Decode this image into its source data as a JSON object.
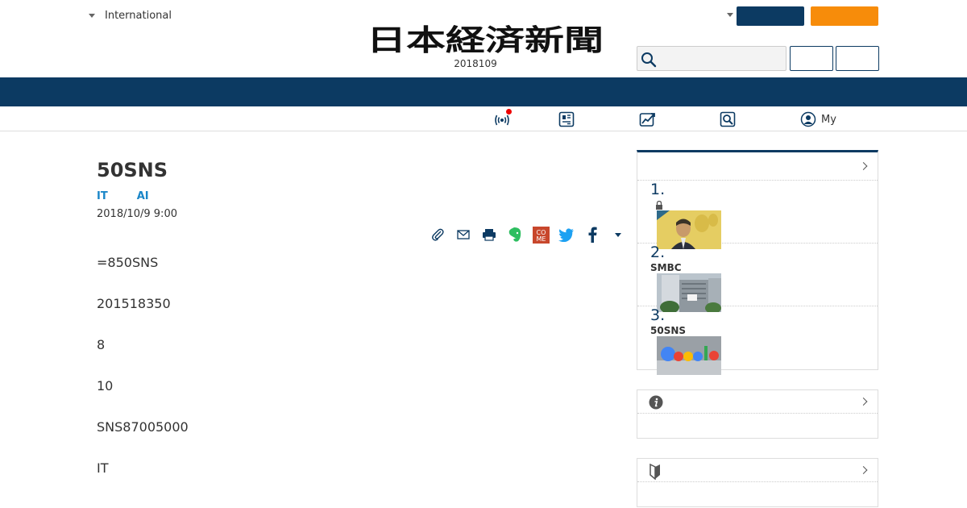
{
  "header": {
    "edition_label": "International",
    "masthead": "日本経済新聞",
    "issue_date": "2018109",
    "search": {
      "placeholder": ""
    },
    "subscribe_label": "",
    "trial_label": "",
    "login_label": "",
    "register_label": ""
  },
  "sub_nav": {
    "my_label": "My"
  },
  "article": {
    "title": "50SNS",
    "tags": [
      "IT",
      "AI"
    ],
    "date": "2018/10/9 9:00",
    "share_come_label": "CO\nME",
    "paragraphs": [
      "=850SNS",
      "201518350",
      "8",
      "10",
      "SNS87005000",
      "IT"
    ]
  },
  "ranking": {
    "items": [
      {
        "num": "1.",
        "label": ""
      },
      {
        "num": "2.",
        "label": "SMBC"
      },
      {
        "num": "3.",
        "label": "50SNS"
      }
    ]
  },
  "colors": {
    "navy": "#0c3a62",
    "orange": "#f78c0a",
    "tag_blue": "#1a86c8",
    "notice_red": "#e00000"
  }
}
